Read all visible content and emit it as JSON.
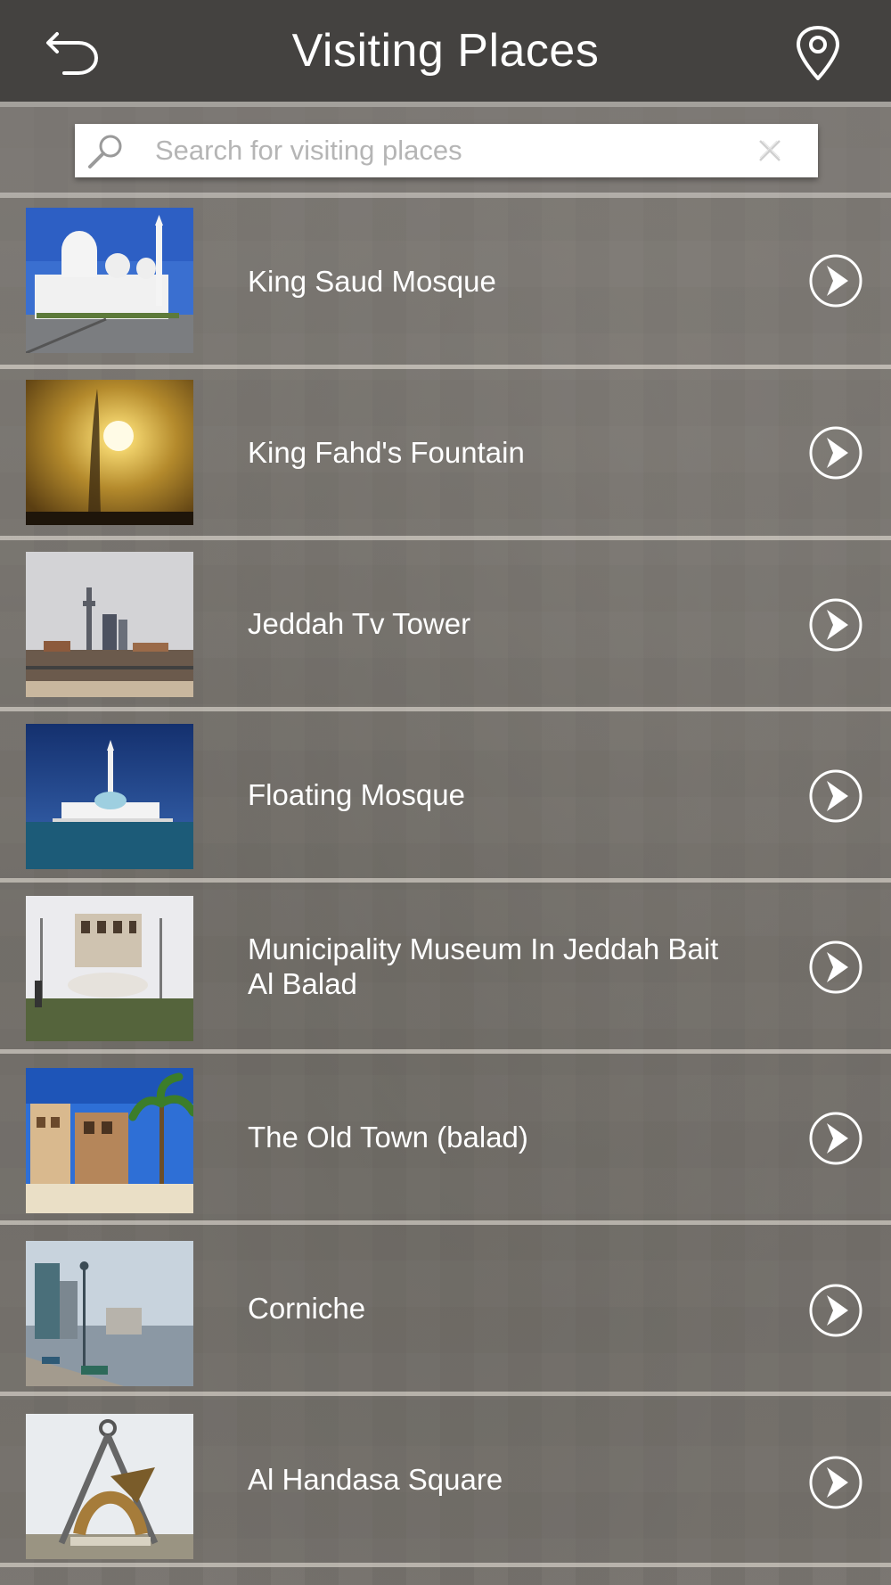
{
  "header": {
    "title": "Visiting Places",
    "back_icon": "back-arrow-icon",
    "location_icon": "map-pin-icon"
  },
  "search": {
    "placeholder": "Search for visiting places",
    "value": ""
  },
  "places": [
    {
      "name": "King Saud Mosque"
    },
    {
      "name": "King Fahd's Fountain"
    },
    {
      "name": "Jeddah Tv Tower"
    },
    {
      "name": "Floating Mosque"
    },
    {
      "name": "Municipality Museum In Jeddah Bait Al Balad"
    },
    {
      "name": "The Old Town (balad)"
    },
    {
      "name": "Corniche"
    },
    {
      "name": "Al Handasa Square"
    }
  ],
  "colors": {
    "header_bg": "#444240",
    "text": "#ffffff",
    "placeholder": "#b5b5b5"
  }
}
